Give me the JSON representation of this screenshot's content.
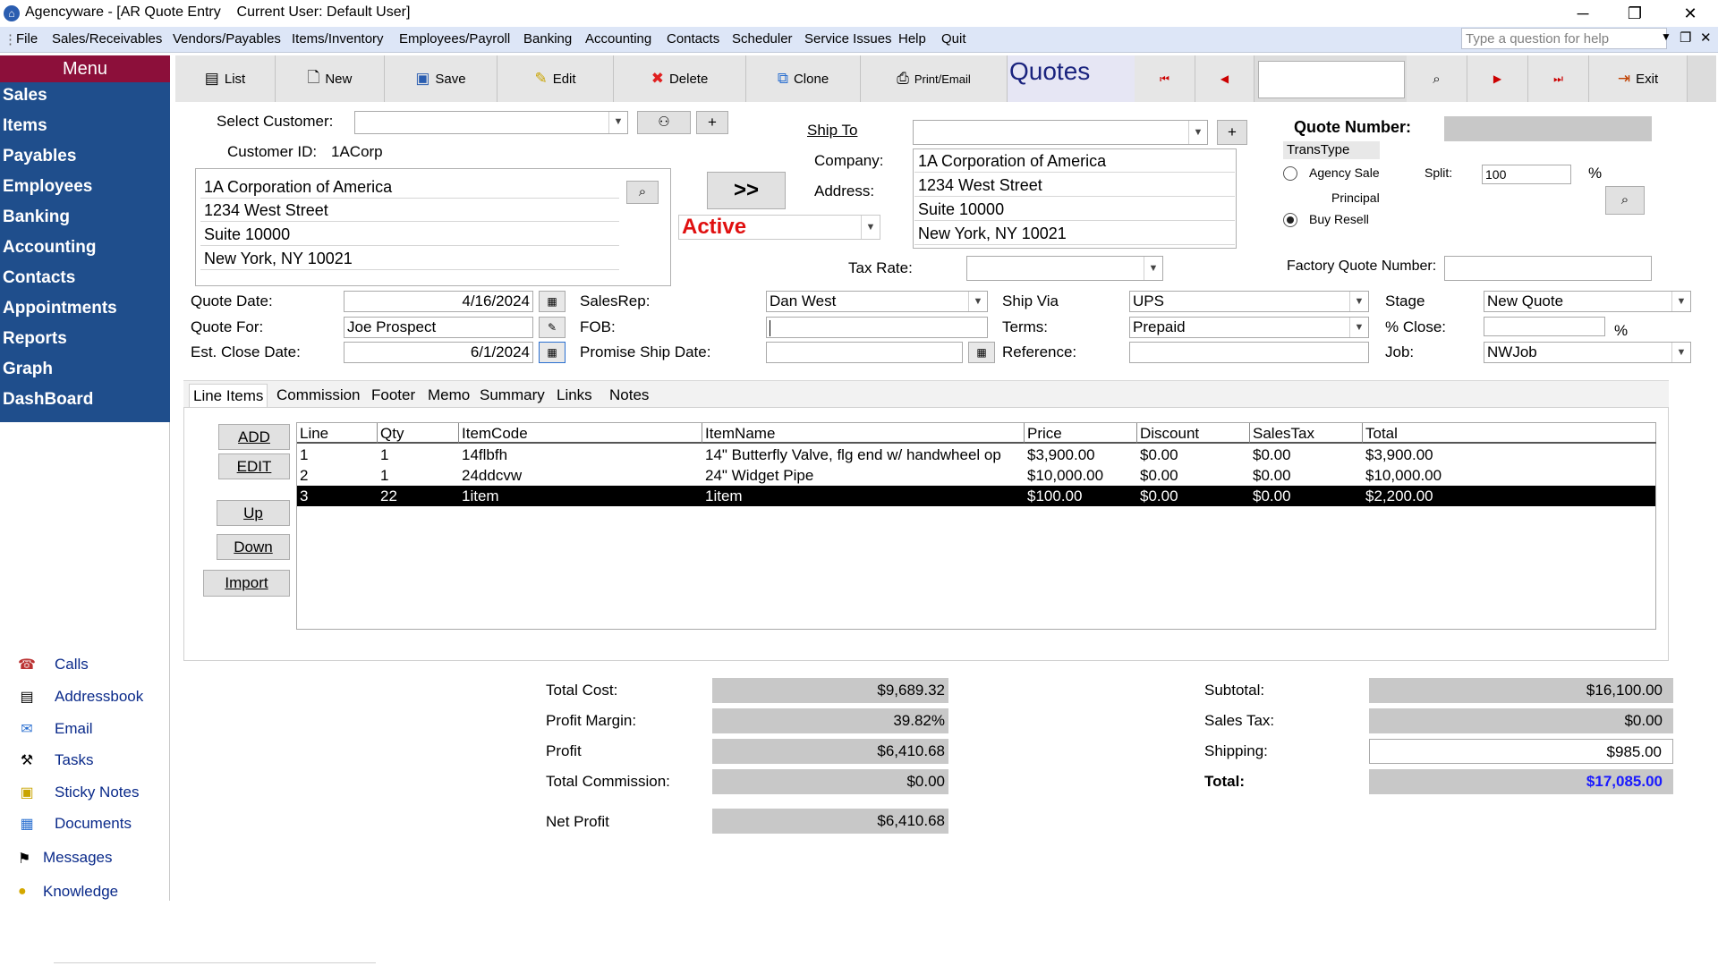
{
  "window": {
    "title": "Agencyware - [AR Quote Entry",
    "current_user": "Current User: Default User]",
    "minimize": "─",
    "maximize": "❐",
    "close": "✕"
  },
  "menubar": {
    "items": [
      "File",
      "Sales/Receivables",
      "Vendors/Payables",
      "Items/Inventory",
      "Employees/Payroll",
      "Banking",
      "Accounting",
      "Contacts",
      "Scheduler",
      "Service Issues",
      "Help",
      "Quit"
    ],
    "help_placeholder": "Type a question for help"
  },
  "sidebar": {
    "title": "Menu",
    "items": [
      "Sales",
      "Items",
      "Payables",
      "Employees",
      "Banking",
      "Accounting",
      "Contacts",
      "Appointments",
      "Reports",
      "Graph",
      "DashBoard"
    ],
    "tools": [
      {
        "label": "Calls",
        "icon": "phone-icon"
      },
      {
        "label": "Addressbook",
        "icon": "addressbook-icon"
      },
      {
        "label": "Email",
        "icon": "email-icon"
      },
      {
        "label": "Tasks",
        "icon": "tasks-icon"
      },
      {
        "label": "Sticky Notes",
        "icon": "sticky-notes-icon"
      },
      {
        "label": "Documents",
        "icon": "documents-icon"
      },
      {
        "label": "Messages",
        "icon": "messages-icon"
      },
      {
        "label": "Knowledge",
        "icon": "knowledge-icon"
      }
    ]
  },
  "toolbar": {
    "list": "List",
    "new": "New",
    "save": "Save",
    "edit": "Edit",
    "delete": "Delete",
    "clone": "Clone",
    "print_email": "Print/Email",
    "title": "Quotes",
    "exit": "Exit"
  },
  "customer": {
    "select_label": "Select Customer:",
    "id_label": "Customer ID:",
    "id_value": "1ACorp",
    "address": [
      "1A Corporation of America",
      "1234 West Street",
      "Suite 10000",
      "New York, NY 10021"
    ],
    "copy_button": ">>",
    "status": "Active"
  },
  "ship_to": {
    "label": "Ship To",
    "company_label": "Company:",
    "address_label": "Address:",
    "company": "1A Corporation of America",
    "address": [
      "1234 West Street",
      "Suite 10000",
      "New York, NY 10021"
    ],
    "tax_rate_label": "Tax Rate:"
  },
  "quote_info": {
    "number_label": "Quote Number:",
    "trans_type_label": "TransType",
    "agency_sale": "Agency Sale",
    "split_label": "Split:",
    "split_value": "100",
    "percent": "%",
    "principal_label": "Principal",
    "buy_resell": "Buy Resell",
    "factory_quote_label": "Factory Quote Number:"
  },
  "fields": {
    "quote_date_label": "Quote Date:",
    "quote_date": "4/16/2024",
    "quote_for_label": "Quote For:",
    "quote_for": "Joe Prospect",
    "close_date_label": "Est. Close Date:",
    "close_date": "6/1/2024",
    "salesrep_label": "SalesRep:",
    "salesrep": "Dan West",
    "fob_label": "FOB:",
    "promise_label": "Promise Ship Date:",
    "ship_via_label": "Ship Via",
    "ship_via": "UPS",
    "terms_label": "Terms:",
    "terms": "Prepaid",
    "reference_label": "Reference:",
    "stage_label": "Stage",
    "stage": "New Quote",
    "pct_close_label": "% Close:",
    "pct_sign": "%",
    "job_label": "Job:",
    "job": "NWJob"
  },
  "tabs": [
    "Line Items",
    "Commission",
    "Footer",
    "Memo",
    "Summary",
    "Links",
    "Notes"
  ],
  "line_buttons": {
    "add": "ADD",
    "edit": "EDIT",
    "up": "Up",
    "down": "Down",
    "import": "Import"
  },
  "grid": {
    "columns": [
      "Line",
      "Qty",
      "ItemCode",
      "ItemName",
      "Price",
      "Discount",
      "SalesTax",
      "Total"
    ],
    "rows": [
      [
        "1",
        "1",
        "14flbfh",
        "14\" Butterfly Valve, flg end w/ handwheel op",
        "$3,900.00",
        "$0.00",
        "$0.00",
        "$3,900.00"
      ],
      [
        "2",
        "1",
        "24ddcvw",
        "24\" Widget Pipe",
        "$10,000.00",
        "$0.00",
        "$0.00",
        "$10,000.00"
      ],
      [
        "3",
        "22",
        "1item",
        "1item",
        "$100.00",
        "$0.00",
        "$0.00",
        "$2,200.00"
      ]
    ],
    "selected_row": 2
  },
  "totals": {
    "total_cost_label": "Total Cost:",
    "total_cost": "$9,689.32",
    "profit_margin_label": "Profit Margin:",
    "profit_margin": "39.82%",
    "profit_label": "Profit",
    "profit": "$6,410.68",
    "total_commission_label": "Total Commission:",
    "total_commission": "$0.00",
    "net_profit_label": "Net Profit",
    "net_profit": "$6,410.68",
    "subtotal_label": "Subtotal:",
    "subtotal": "$16,100.00",
    "sales_tax_label": "Sales Tax:",
    "sales_tax": "$0.00",
    "shipping_label": "Shipping:",
    "shipping": "$985.00",
    "total_label": "Total:",
    "total": "$17,085.00"
  },
  "colors": {
    "sidebar_bg": "#1f4e8c",
    "menu_header_bg": "#8c0f3a",
    "status_active": "#e01010",
    "total_value": "#1a1aff"
  }
}
